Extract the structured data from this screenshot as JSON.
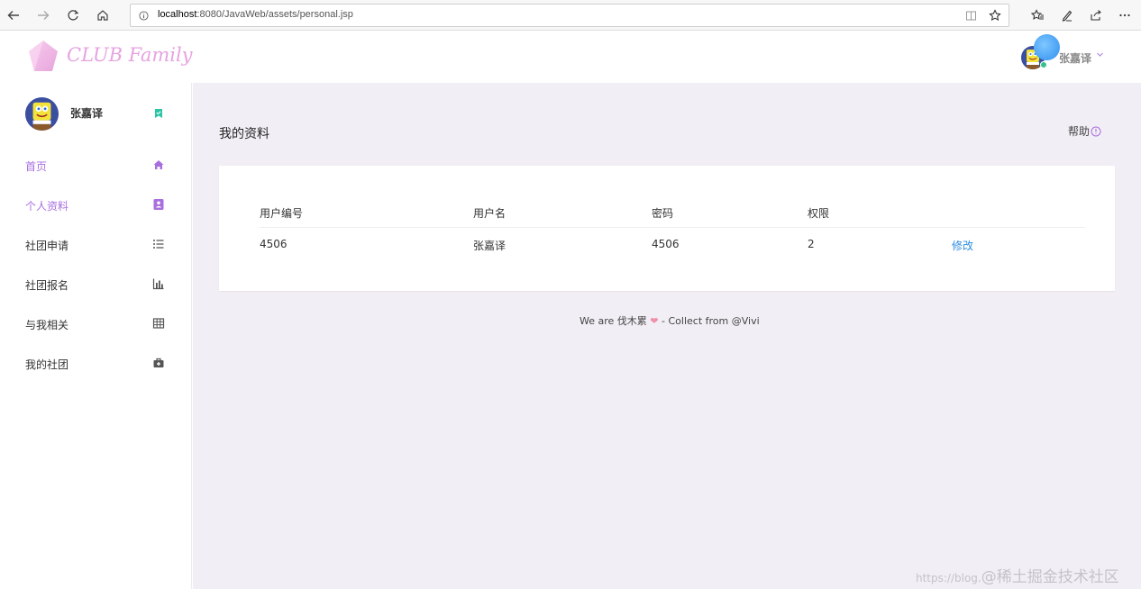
{
  "browser": {
    "url_host": "localhost",
    "url_path": ":8080/JavaWeb/assets/personal.jsp"
  },
  "app": {
    "logo_text": "CLUB Family",
    "brand_color": "#e6a3e0",
    "accent_color": "#a96ee0"
  },
  "header": {
    "username": "张嘉译"
  },
  "sidebar": {
    "username": "张嘉译",
    "items": [
      {
        "label": "首页",
        "icon": "home-icon",
        "active": true
      },
      {
        "label": "个人资料",
        "icon": "id-card-icon",
        "active": true
      },
      {
        "label": "社团申请",
        "icon": "list-icon",
        "active": false
      },
      {
        "label": "社团报名",
        "icon": "bar-chart-icon",
        "active": false
      },
      {
        "label": "与我相关",
        "icon": "table-icon",
        "active": false
      },
      {
        "label": "我的社团",
        "icon": "briefcase-icon",
        "active": false
      }
    ]
  },
  "main": {
    "title": "我的资料",
    "help_label": "帮助",
    "table": {
      "headers": [
        "用户编号",
        "用户名",
        "密码",
        "权限"
      ],
      "rows": [
        {
          "id": "4506",
          "username": "张嘉译",
          "password": "4506",
          "permission": "2",
          "action": "修改"
        }
      ]
    },
    "footer": {
      "prefix": "We are 伐木累",
      "suffix": "- Collect from @Vivi"
    }
  },
  "watermark": {
    "prefix": "https://blog.",
    "text": "@稀土掘金技术社区"
  }
}
